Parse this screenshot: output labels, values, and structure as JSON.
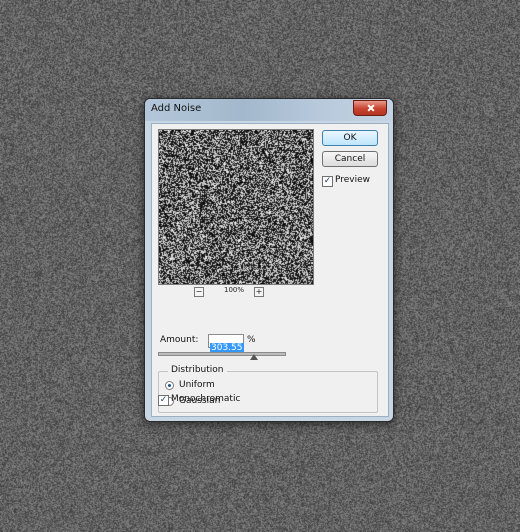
{
  "dialog": {
    "title": "Add Noise",
    "ok_label": "OK",
    "cancel_label": "Cancel",
    "preview": {
      "label": "Preview",
      "checked": true
    },
    "zoom": {
      "minus": "−",
      "level": "100%",
      "plus": "+"
    },
    "amount": {
      "label": "Amount:",
      "value": "303.55",
      "unit": "%",
      "slider_fraction": 0.76
    },
    "distribution": {
      "legend": "Distribution",
      "options": [
        {
          "label": "Uniform",
          "selected": true
        },
        {
          "label": "Gaussian",
          "selected": false
        }
      ]
    },
    "monochromatic": {
      "label": "Monochromatic",
      "checked": true
    }
  },
  "icons": {
    "close": "close-icon",
    "check": "checkmark-icon"
  },
  "colors": {
    "ok_highlight": "#3399ff",
    "close_button": "#c8432f",
    "background_noise": "#5f5f5f"
  }
}
